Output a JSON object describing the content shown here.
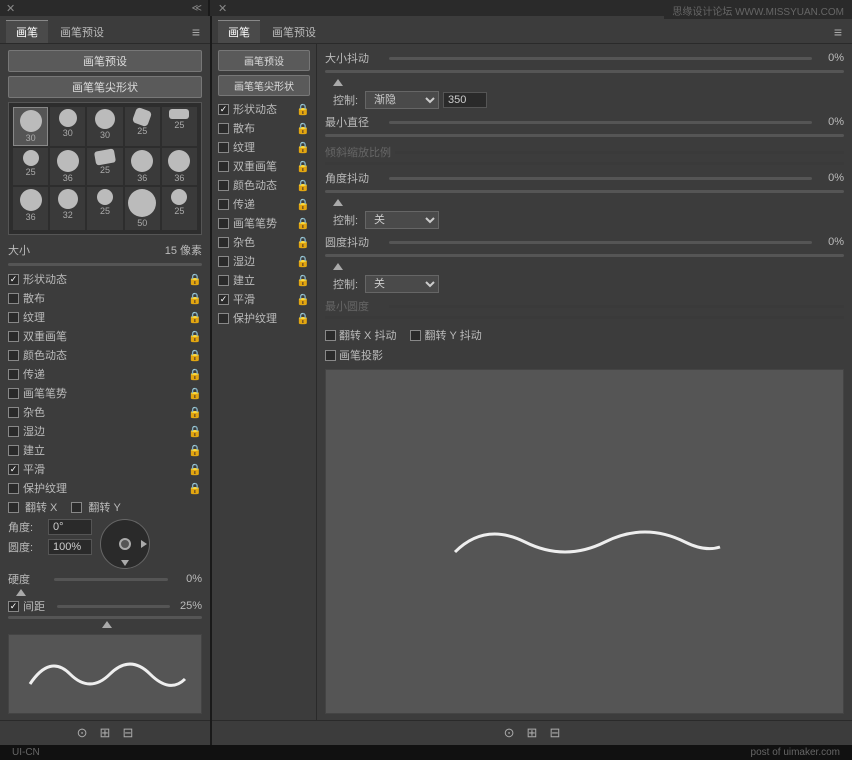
{
  "watermark": "思缘设计论坛 WWW.MISSYUAN.COM",
  "tabs": {
    "brush": "画笔",
    "brush_preset": "画笔预设"
  },
  "left_panel": {
    "preset_btn": "画笔预设",
    "tip_btn": "画笔笔尖形状",
    "menu_icon": "≡",
    "brushes": [
      {
        "size": "30",
        "type": "round"
      },
      {
        "size": "30",
        "type": "round-sm"
      },
      {
        "size": "30",
        "type": "round-md"
      },
      {
        "size": "25",
        "type": "star"
      },
      {
        "size": "25",
        "type": "wide"
      },
      {
        "size": "25",
        "type": "round"
      },
      {
        "size": "36",
        "type": "round"
      },
      {
        "size": "25",
        "type": "leaf"
      },
      {
        "size": "36",
        "type": "round"
      },
      {
        "size": "36",
        "type": "round"
      },
      {
        "size": "36",
        "type": "round"
      },
      {
        "size": "32",
        "type": "round"
      },
      {
        "size": "25",
        "type": "round"
      },
      {
        "size": "50",
        "type": "round"
      },
      {
        "size": "25",
        "type": "round"
      }
    ],
    "sections": [
      {
        "label": "形状动态",
        "checked": true,
        "locked": true
      },
      {
        "label": "散布",
        "checked": false,
        "locked": true
      },
      {
        "label": "纹理",
        "checked": false,
        "locked": true
      },
      {
        "label": "双重画笔",
        "checked": false,
        "locked": true
      },
      {
        "label": "颜色动态",
        "checked": false,
        "locked": true
      },
      {
        "label": "传递",
        "checked": false,
        "locked": true
      },
      {
        "label": "画笔笔势",
        "checked": false,
        "locked": true
      },
      {
        "label": "杂色",
        "checked": false,
        "locked": true
      },
      {
        "label": "湿边",
        "checked": false,
        "locked": true
      },
      {
        "label": "建立",
        "checked": false,
        "locked": true
      },
      {
        "label": "平滑",
        "checked": true,
        "locked": true
      },
      {
        "label": "保护纹理",
        "checked": false,
        "locked": true
      }
    ],
    "size_label": "大小",
    "size_value": "15 像素",
    "flip_x": "翻转 X",
    "flip_y": "翻转 Y",
    "angle_label": "角度:",
    "angle_value": "0°",
    "roundness_label": "圆度:",
    "roundness_value": "100%",
    "hardness_label": "硬度",
    "hardness_value": "0%",
    "spacing_label": "间距",
    "spacing_value": "25%",
    "bottom_icons": [
      "⊙",
      "⊞",
      "⊟"
    ]
  },
  "right_panel": {
    "preset_btn": "画笔预设",
    "tip_btn": "画笔笔尖形状",
    "menu_icon": "≡",
    "sections": [
      {
        "label": "形状动态",
        "checked": true,
        "locked": true
      },
      {
        "label": "散布",
        "checked": false,
        "locked": true
      },
      {
        "label": "纹理",
        "checked": false,
        "locked": true
      },
      {
        "label": "双重画笔",
        "checked": false,
        "locked": true
      },
      {
        "label": "颜色动态",
        "checked": false,
        "locked": true
      },
      {
        "label": "传递",
        "checked": false,
        "locked": true
      },
      {
        "label": "画笔笔势",
        "checked": false,
        "locked": true
      },
      {
        "label": "杂色",
        "checked": false,
        "locked": true
      },
      {
        "label": "湿边",
        "checked": false,
        "locked": true
      },
      {
        "label": "建立",
        "checked": false,
        "locked": true
      },
      {
        "label": "平滑",
        "checked": true,
        "locked": true
      },
      {
        "label": "保护纹理",
        "checked": false,
        "locked": true
      }
    ],
    "size_jitter_label": "大小抖动",
    "size_jitter_value": "0%",
    "control_label": "控制:",
    "control_fade": "渐隐",
    "control_value": "350",
    "min_diameter_label": "最小直径",
    "min_diameter_value": "0%",
    "tilt_label": "倾斜缩放比例",
    "angle_jitter_label": "角度抖动",
    "angle_jitter_value": "0%",
    "control2_label": "控制:",
    "control2_value": "关",
    "roundness_jitter_label": "圆度抖动",
    "roundness_jitter_value": "0%",
    "control3_label": "控制:",
    "control3_value": "关",
    "min_roundness_label": "最小圆度",
    "flip_x_label": "翻转 X 抖动",
    "flip_y_label": "翻转 Y 抖动",
    "projection_label": "画笔投影",
    "bottom_icons": [
      "⊙",
      "⊞",
      "⊟"
    ]
  },
  "bottom": {
    "ui_cn": "UI-CN",
    "post_text": "post of uimaker.com"
  }
}
